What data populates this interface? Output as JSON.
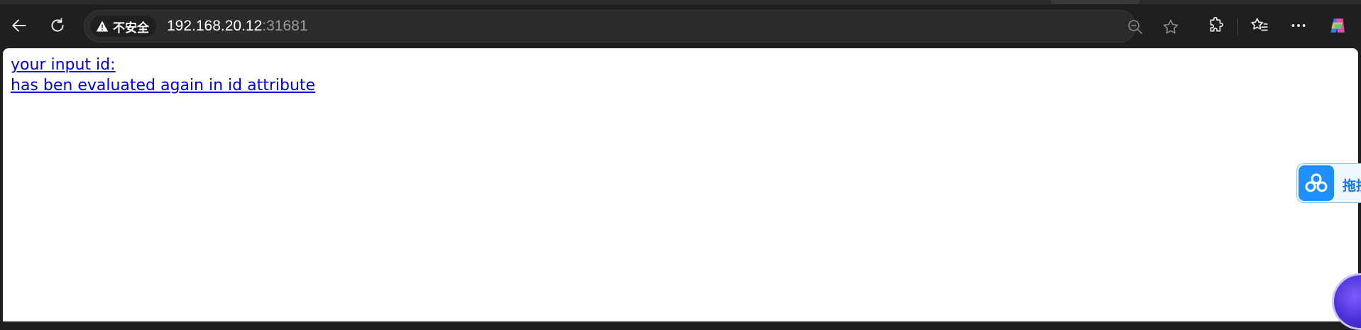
{
  "browser": {
    "security_label": "不安全",
    "url_host": "192.168.20.12",
    "url_port": ":31681",
    "icons": {
      "back": "back-arrow-icon",
      "refresh": "refresh-icon",
      "warning": "warning-triangle-icon",
      "zoom": "zoom-out-icon",
      "favorite": "star-icon",
      "extensions": "puzzle-icon",
      "favorites": "favorites-list-icon",
      "more": "ellipsis-icon",
      "copilot": "copilot-icon"
    }
  },
  "page": {
    "line1": "your input id:",
    "line2": "has ben evaluated again in id attribute"
  },
  "side_widget": {
    "label": "拖拽",
    "icon": "baidu-cloud-icon"
  },
  "colors": {
    "chrome_bg": "#1f1f1f",
    "link": "#0000ee",
    "widget_blue": "#1e8fff"
  }
}
